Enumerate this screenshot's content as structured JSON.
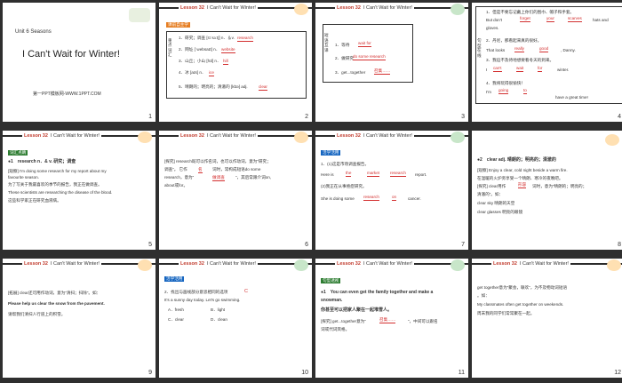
{
  "common": {
    "lesson": "Lesson 32",
    "title": "I Can't Wait for Winter!"
  },
  "s1": {
    "unit": "Unit 6   Seasons",
    "title": "I Can't Wait for Winter!",
    "footer": "第一PPT模板网-WWW.1PPT.COM",
    "num": "1"
  },
  "s2": {
    "tag": "课前自主学",
    "side": "重点词汇",
    "num": "2",
    "lines": [
      "1．研究；调查 [rɪˈsɜːtʃ] n．＆v.",
      "2．网址 [ˈwebsaɪt] n．",
      "3．山丘；小山 [hɪl] n．",
      "4．冰 [aɪs] n．",
      "5．晴朗的；明亮的；清澈的 [klɪə] adj."
    ],
    "ans": [
      "research",
      "website",
      "hill",
      "ice",
      "clear"
    ]
  },
  "s3": {
    "side": "短语互译",
    "num": "3",
    "lines": [
      "1．等待",
      "2．做研究",
      "3．get...together"
    ],
    "ans": [
      "wait for",
      "do some research",
      "召集……"
    ]
  },
  "s4": {
    "side": "句型在线",
    "num": "4",
    "lines": [
      "1．但是不要忘记戴上你们的围巾、帽子和手套。",
      "But don't",
      "hats and",
      "gloves.",
      "2．丹尼，那看起来真的很好。",
      "That looks",
      ", Danny.",
      "3．我迫不及待地想要看冬天的到来。",
      "I",
      "winter.",
      "4．我将玩得很愉快！",
      "I'm",
      "have a great time!"
    ],
    "ans": [
      "forget",
      "your",
      "scarves",
      "really",
      "good",
      "can't",
      "wait",
      "for",
      "going",
      "to"
    ]
  },
  "s5": {
    "tag": "词汇点睛",
    "num": "5",
    "head": "●1　research n．& v. 研究；调查",
    "lines": [
      "[观察] I'm doing some research for my report about my",
      "favourite season.",
      "为了写关于我最喜欢的季节的报告，我正在做调查。",
      "These scientists are researching the disease of the blood.",
      "这些科学家正在研究血液病。"
    ]
  },
  "s6": {
    "num": "6",
    "lines": [
      "[探究] research既可以作名词，也可以作动词，意为“研究；",
      "调查”。 它作",
      "词时，常构成短语do some",
      "research，意为“",
      "”，其后常跟介词on,",
      "about或for。"
    ],
    "ans": [
      "名",
      "做调查"
    ]
  },
  "s7": {
    "tag": "活学活用",
    "num": "7",
    "lines": [
      "1．(1)这是市场调查报告。",
      "Here is",
      "report.",
      "(2)我正在从事癌症研究。",
      "She is doing some",
      "cancer."
    ],
    "ans": [
      "the",
      "market",
      "research",
      "research",
      "on"
    ]
  },
  "s8": {
    "num": "8",
    "head": "●2　clear adj. 晴朗的；明亮的；清澈的",
    "lines": [
      "[观察] Enjoy a clear, cold night beside a warm fire.",
      "在温暖的火炉旁享受一个晴朗、寒冷的夜晚吧。",
      "[探究] clear用作",
      "词时，意为“晴朗的；明亮的；",
      "清澈的”。如：",
      "clear sky 晴朗的天空",
      "clear glasses 明亮的眼镜"
    ],
    "ans": [
      "形容"
    ]
  },
  "s9": {
    "num": "9",
    "lines": [
      "[拓展] clear还可用作动词，意为“清扫；扫除”。如：",
      "Please help us clear the snow from the pavement.",
      "请帮我们清扫人行道上的积雪。"
    ]
  },
  "s10": {
    "tag": "活学活用",
    "num": "10",
    "lines": [
      "2．找出与画线部分意思相同的选项",
      "It's a sunny day today. Let's go swimming.",
      "A．fresh",
      "B．light",
      "C．clear",
      "D．clean"
    ],
    "ans": [
      "C"
    ]
  },
  "s11": {
    "tag": "句型透视",
    "num": "11",
    "lines": [
      "●1　You can even get the family together and make a",
      "snowman.",
      "你甚至可以把家人聚在一起堆雪人。",
      "[探究] get...together意为“",
      "”，中间可以跟名",
      "词或代词宾格。"
    ],
    "ans": [
      "召集……"
    ]
  },
  "s12": {
    "num": "12",
    "lines": [
      "get together意为“聚会，联欢”，为不及物动词短语",
      "。如：",
      "My classmates often get together on weekends.",
      "周末我的同学们常常聚在一起。"
    ]
  }
}
